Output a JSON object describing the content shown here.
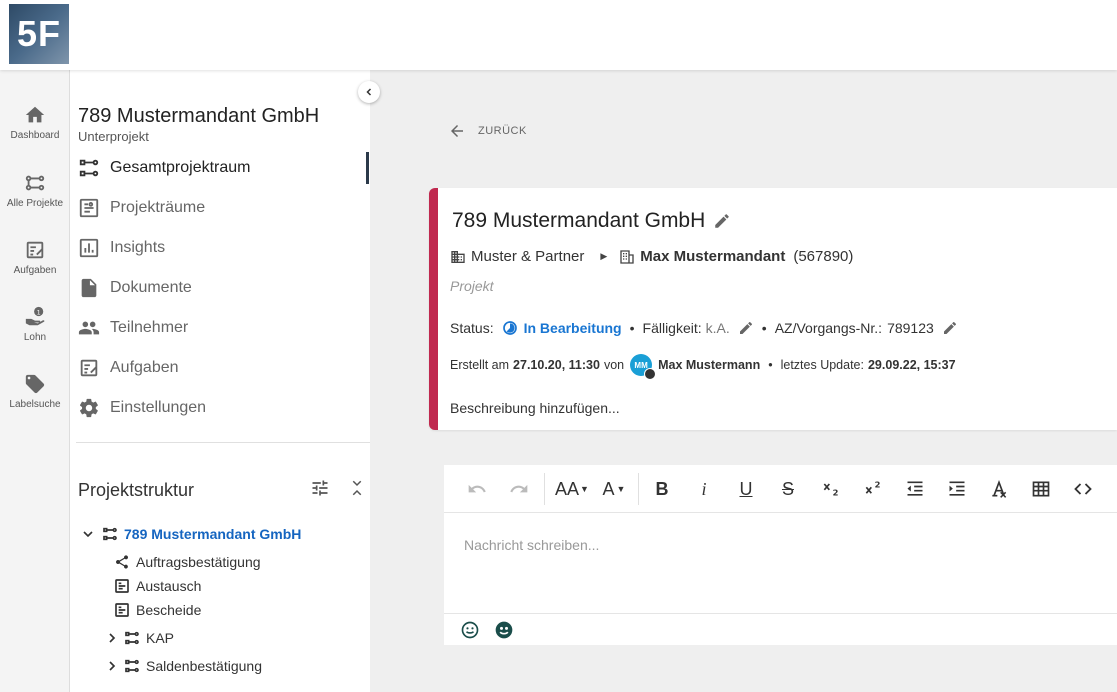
{
  "logo": {
    "text": "5F"
  },
  "rail": {
    "items": [
      {
        "label": "Dashboard",
        "icon": "home-icon"
      },
      {
        "label": "Alle Projekte",
        "icon": "projects-icon"
      },
      {
        "label": "Aufgaben",
        "icon": "tasks-icon"
      },
      {
        "label": "Lohn",
        "icon": "wage-icon"
      },
      {
        "label": "Labelsuche",
        "icon": "label-icon"
      }
    ]
  },
  "sidebar": {
    "title": "789 Mustermandant GmbH",
    "subtitle": "Unterprojekt",
    "nav": [
      {
        "label": "Gesamtprojektraum",
        "icon": "project-tree-icon"
      },
      {
        "label": "Projekträume",
        "icon": "rooms-icon"
      },
      {
        "label": "Insights",
        "icon": "chart-icon"
      },
      {
        "label": "Dokumente",
        "icon": "document-icon"
      },
      {
        "label": "Teilnehmer",
        "icon": "people-icon"
      },
      {
        "label": "Aufgaben",
        "icon": "tasks-icon"
      },
      {
        "label": "Einstellungen",
        "icon": "gear-icon"
      }
    ],
    "structure": {
      "title": "Projektstruktur",
      "root": "789 Mustermandant GmbH",
      "children": [
        {
          "label": "Auftragsbestätigung",
          "icon": "share-icon"
        },
        {
          "label": "Austausch",
          "icon": "room-icon"
        },
        {
          "label": "Bescheide",
          "icon": "room-icon"
        },
        {
          "label": "KAP",
          "icon": "project-tree-icon",
          "expandable": true
        },
        {
          "label": "Saldenbestätigung",
          "icon": "project-tree-icon",
          "expandable": true
        }
      ]
    }
  },
  "main": {
    "back_label": "ZURÜCK",
    "card": {
      "title": "789 Mustermandant GmbH",
      "org": "Muster & Partner",
      "client": "Max Mustermandant",
      "client_number": "(567890)",
      "type": "Projekt",
      "status_label": "Status:",
      "status_value": "In Bearbeitung",
      "due_label": "Fälligkeit:",
      "due_value": "k.A.",
      "az_label": "AZ/Vorgangs-Nr.:",
      "az_value": "789123",
      "created_prefix": "Erstellt am",
      "created_date": "27.10.20, 11:30",
      "created_by_word": "von",
      "creator_initials": "MM",
      "creator_name": "Max Mustermann",
      "update_label": "letztes Update:",
      "update_date": "29.09.22, 15:37",
      "description_placeholder": "Beschreibung hinzufügen..."
    },
    "editor": {
      "placeholder": "Nachricht schreiben...",
      "toolbar": {
        "font_size": "AA",
        "font_color": "A",
        "bold": "B",
        "italic": "i",
        "underline": "U",
        "strike": "S"
      }
    }
  },
  "colors": {
    "accent_blue": "#1976d2",
    "card_border": "#c0294f",
    "avatar": "#1a9fd6"
  }
}
